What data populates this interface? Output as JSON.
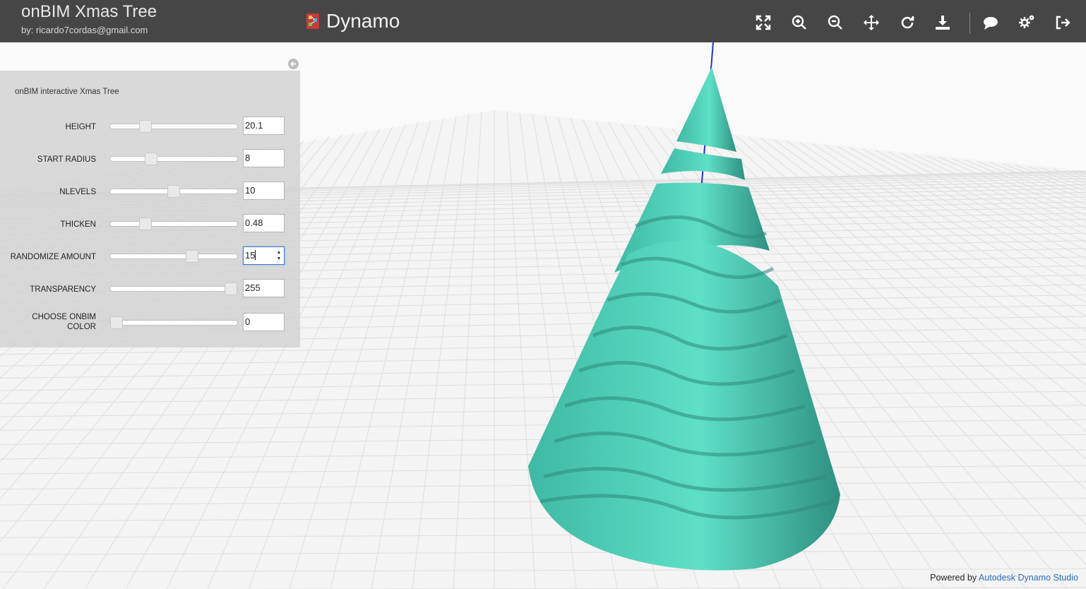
{
  "header": {
    "title": "onBIM Xmas Tree",
    "author": "by: ricardo7cordas@gmail.com",
    "brand": "Dynamo"
  },
  "toolbar": {
    "icons": [
      "fullscreen-icon",
      "zoom-in-icon",
      "zoom-out-icon",
      "pan-icon",
      "rotate-icon",
      "download-icon",
      "comment-icon",
      "settings-icon",
      "exit-icon"
    ]
  },
  "panel": {
    "title": "onBIM interactive Xmas Tree",
    "rows": [
      {
        "label": "HEIGHT",
        "value": "20.1",
        "fraction": 0.25
      },
      {
        "label": "START RADIUS",
        "value": "8",
        "fraction": 0.3
      },
      {
        "label": "NLEVELS",
        "value": "10",
        "fraction": 0.5
      },
      {
        "label": "THICKEN",
        "value": "0.48",
        "fraction": 0.25
      },
      {
        "label": "RANDOMIZE AMOUNT",
        "value": "15",
        "fraction": 0.66
      },
      {
        "label": "TRANSPARENCY",
        "value": "255",
        "fraction": 1.0
      },
      {
        "label": "CHOOSE ONBIM COLOR",
        "value": "0",
        "fraction": 0.0
      }
    ]
  },
  "scene": {
    "tree_color": "#45c4ae",
    "axis_color": "#2233cc",
    "grid_color": "#dedede"
  },
  "footer": {
    "prefix": "Powered by",
    "link": "Autodesk Dynamo Studio"
  }
}
